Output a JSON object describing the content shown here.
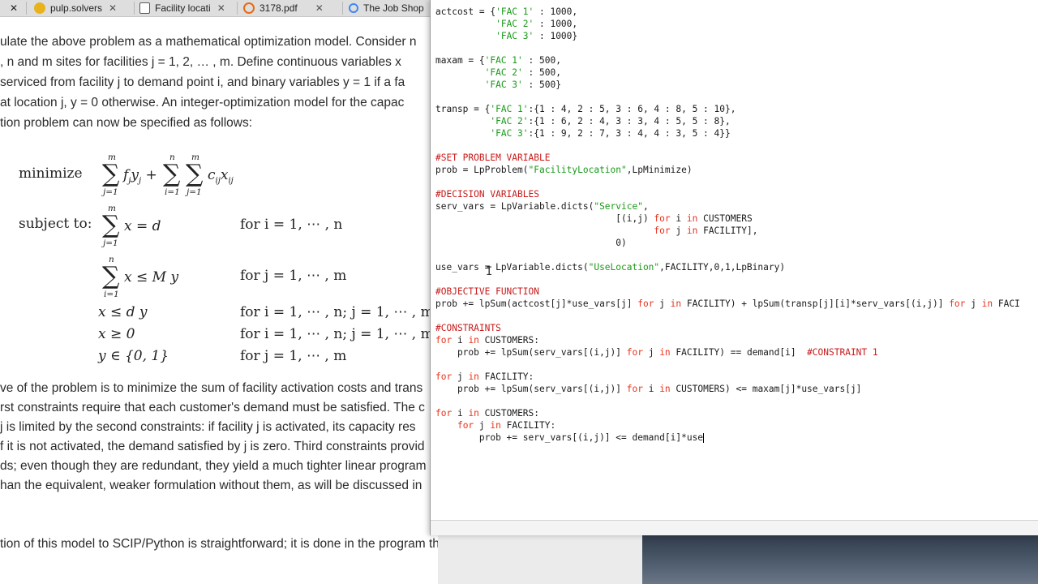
{
  "tabs": [
    {
      "label": "pulp.solvers",
      "icon": "pulp-icon",
      "color": "#e8b21a"
    },
    {
      "label": "Facility locati",
      "icon": "document-icon",
      "color": "#5a5a5a"
    },
    {
      "label": "3178.pdf",
      "icon": "pdf-icon",
      "color": "#e86a10"
    },
    {
      "label": "The Job Shop",
      "icon": "google-icon",
      "color": "#4285f4"
    }
  ],
  "document": {
    "lines": [
      {
        "text": "ulate the above problem as a mathematical optimization model. Consider n"
      },
      {
        "text": ", n and m sites for facilities j = 1, 2, … , m. Define continuous variables x"
      },
      {
        "text": " serviced from facility j to demand point i, and binary variables y  = 1 if a fa"
      },
      {
        "text": "at location j, y  = 0 otherwise. An integer-optimization model for the capac"
      },
      {
        "text": "tion problem can now be specified as follows:"
      }
    ],
    "minimize_label": "minimize",
    "subject_to_label": "subject to:",
    "constraints": [
      {
        "lhs": "x   = d",
        "cond": "for i = 1, ⋯ , n"
      },
      {
        "lhs": "x   ≤ M y",
        "cond": "for j = 1, ⋯ , m"
      },
      {
        "lhs": "x   ≤ d y",
        "cond": "for i = 1, ⋯ , n; j = 1, ⋯ , m"
      },
      {
        "lhs": "x   ≥ 0",
        "cond": "for i = 1, ⋯ , n; j = 1, ⋯ , m"
      },
      {
        "lhs": "y  ∈ {0, 1}",
        "cond": "for j = 1, ⋯ , m"
      }
    ],
    "para_lines": [
      {
        "text": "ve of the problem is to minimize the sum of facility activation costs and trans"
      },
      {
        "text": "rst constraints require that each customer's demand must be satisfied. The c"
      },
      {
        "text": "j is limited by the second constraints: if facility j is activated, its capacity res"
      },
      {
        "text": "f it is not activated, the demand satisfied by j is zero. Third constraints provid"
      },
      {
        "text": "ds; even though they are redundant, they yield a much tighter linear program"
      },
      {
        "text": "han the equivalent, weaker formulation without them, as will be discussed in"
      },
      {
        "text": "tion of this model to SCIP/Python is straightforward; it is done in the program that"
      }
    ]
  },
  "code_lines": [
    {
      "segs": [
        {
          "t": "actcost = {"
        },
        {
          "t": "'FAC 1'",
          "c": "str"
        },
        {
          "t": " : 1000,"
        }
      ]
    },
    {
      "segs": [
        {
          "t": "           "
        },
        {
          "t": "'FAC 2'",
          "c": "str"
        },
        {
          "t": " : 1000,"
        }
      ]
    },
    {
      "segs": [
        {
          "t": "           "
        },
        {
          "t": "'FAC 3'",
          "c": "str"
        },
        {
          "t": " : 1000}"
        }
      ]
    },
    {
      "segs": [
        {
          "t": ""
        }
      ]
    },
    {
      "segs": [
        {
          "t": "maxam = {"
        },
        {
          "t": "'FAC 1'",
          "c": "str"
        },
        {
          "t": " : 500,"
        }
      ]
    },
    {
      "segs": [
        {
          "t": "         "
        },
        {
          "t": "'FAC 2'",
          "c": "str"
        },
        {
          "t": " : 500,"
        }
      ]
    },
    {
      "segs": [
        {
          "t": "         "
        },
        {
          "t": "'FAC 3'",
          "c": "str"
        },
        {
          "t": " : 500}"
        }
      ]
    },
    {
      "segs": [
        {
          "t": ""
        }
      ]
    },
    {
      "segs": [
        {
          "t": "transp = {"
        },
        {
          "t": "'FAC 1'",
          "c": "str"
        },
        {
          "t": ":{1 : 4, 2 : 5, 3 : 6, 4 : 8, 5 : 10},"
        }
      ]
    },
    {
      "segs": [
        {
          "t": "          "
        },
        {
          "t": "'FAC 2'",
          "c": "str"
        },
        {
          "t": ":{1 : 6, 2 : 4, 3 : 3, 4 : 5, 5 : 8},"
        }
      ]
    },
    {
      "segs": [
        {
          "t": "          "
        },
        {
          "t": "'FAC 3'",
          "c": "str"
        },
        {
          "t": ":{1 : 9, 2 : 7, 3 : 4, 4 : 3, 5 : 4}}"
        }
      ]
    },
    {
      "segs": [
        {
          "t": ""
        }
      ]
    },
    {
      "segs": [
        {
          "t": "#SET PROBLEM VARIABLE",
          "c": "cm"
        }
      ]
    },
    {
      "segs": [
        {
          "t": "prob = LpProblem("
        },
        {
          "t": "\"FacilityLocation\"",
          "c": "str"
        },
        {
          "t": ",LpMinimize)"
        }
      ]
    },
    {
      "segs": [
        {
          "t": ""
        }
      ]
    },
    {
      "segs": [
        {
          "t": "#DECISION VARIABLES",
          "c": "cm"
        }
      ]
    },
    {
      "segs": [
        {
          "t": "serv_vars = LpVariable.dicts("
        },
        {
          "t": "\"Service\"",
          "c": "str"
        },
        {
          "t": ","
        }
      ]
    },
    {
      "segs": [
        {
          "t": "                                 [(i,j) "
        },
        {
          "t": "for",
          "c": "kw"
        },
        {
          "t": " i "
        },
        {
          "t": "in",
          "c": "kw"
        },
        {
          "t": " CUSTOMERS"
        }
      ]
    },
    {
      "segs": [
        {
          "t": "                                        "
        },
        {
          "t": "for",
          "c": "kw"
        },
        {
          "t": " j "
        },
        {
          "t": "in",
          "c": "kw"
        },
        {
          "t": " FACILITY],"
        }
      ]
    },
    {
      "segs": [
        {
          "t": "                                 0)"
        }
      ]
    },
    {
      "segs": [
        {
          "t": ""
        }
      ]
    },
    {
      "segs": [
        {
          "t": "use_vars = LpVariable.dicts("
        },
        {
          "t": "\"UseLocation\"",
          "c": "str"
        },
        {
          "t": ",FACILITY,0,1,LpBinary)"
        }
      ]
    },
    {
      "segs": [
        {
          "t": ""
        }
      ]
    },
    {
      "segs": [
        {
          "t": "#OBJECTIVE FUNCTION",
          "c": "cm"
        }
      ]
    },
    {
      "segs": [
        {
          "t": "prob += lpSum(actcost[j]*use_vars[j] "
        },
        {
          "t": "for",
          "c": "kw"
        },
        {
          "t": " j "
        },
        {
          "t": "in",
          "c": "kw"
        },
        {
          "t": " FACILITY) + lpSum(transp[j][i]*serv_vars[(i,j)] "
        },
        {
          "t": "for",
          "c": "kw"
        },
        {
          "t": " j "
        },
        {
          "t": "in",
          "c": "kw"
        },
        {
          "t": " FACI"
        }
      ]
    },
    {
      "segs": [
        {
          "t": ""
        }
      ]
    },
    {
      "segs": [
        {
          "t": "#CONSTRAINTS",
          "c": "cm"
        }
      ]
    },
    {
      "segs": [
        {
          "t": "for",
          "c": "kw"
        },
        {
          "t": " i "
        },
        {
          "t": "in",
          "c": "kw"
        },
        {
          "t": " CUSTOMERS:"
        }
      ]
    },
    {
      "segs": [
        {
          "t": "    prob += lpSum(serv_vars[(i,j)] "
        },
        {
          "t": "for",
          "c": "kw"
        },
        {
          "t": " j "
        },
        {
          "t": "in",
          "c": "kw"
        },
        {
          "t": " FACILITY) == demand[i]  "
        },
        {
          "t": "#CONSTRAINT 1",
          "c": "cm"
        }
      ]
    },
    {
      "segs": [
        {
          "t": ""
        }
      ]
    },
    {
      "segs": [
        {
          "t": "for",
          "c": "kw"
        },
        {
          "t": " j "
        },
        {
          "t": "in",
          "c": "kw"
        },
        {
          "t": " FACILITY:"
        }
      ]
    },
    {
      "segs": [
        {
          "t": "    prob += lpSum(serv_vars[(i,j)] "
        },
        {
          "t": "for",
          "c": "kw"
        },
        {
          "t": " i "
        },
        {
          "t": "in",
          "c": "kw"
        },
        {
          "t": " CUSTOMERS) <= maxam[j]*use_vars[j]"
        }
      ]
    },
    {
      "segs": [
        {
          "t": ""
        }
      ]
    },
    {
      "segs": [
        {
          "t": "for",
          "c": "kw"
        },
        {
          "t": " i "
        },
        {
          "t": "in",
          "c": "kw"
        },
        {
          "t": " CUSTOMERS:"
        }
      ]
    },
    {
      "segs": [
        {
          "t": "    "
        },
        {
          "t": "for",
          "c": "kw"
        },
        {
          "t": " j "
        },
        {
          "t": "in",
          "c": "kw"
        },
        {
          "t": " FACILITY:"
        }
      ]
    },
    {
      "segs": [
        {
          "t": "        prob += serv_vars[(i,j)] <= demand[i]*use",
          "caret": true
        }
      ]
    }
  ]
}
